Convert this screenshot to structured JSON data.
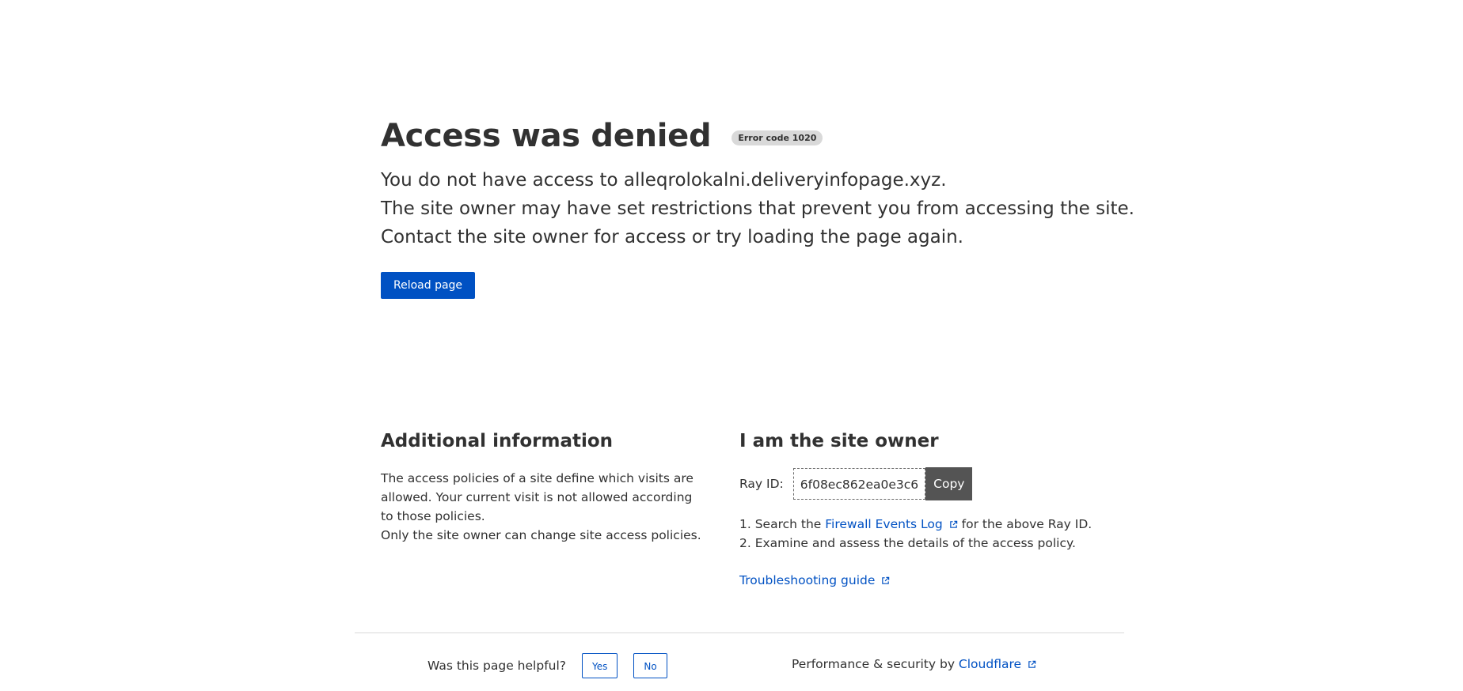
{
  "header": {
    "title": "Access was denied",
    "error_badge": "Error code 1020",
    "desc_line1": "You do not have access to alleqrolokalni.deliveryinfopage.xyz.",
    "desc_line2": "The site owner may have set restrictions that prevent you from accessing the site.",
    "desc_line3": "Contact the site owner for access or try loading the page again.",
    "reload_label": "Reload page"
  },
  "additional_info": {
    "heading": "Additional information",
    "para1": "The access policies of a site define which visits are allowed. Your current visit is not allowed according to those policies.",
    "para2": "Only the site owner can change site access policies."
  },
  "site_owner": {
    "heading": "I am the site owner",
    "ray_label": "Ray ID:",
    "ray_value": "6f08ec862ea0e3c6",
    "copy_label": "Copy",
    "step1_prefix": "1. Search the ",
    "step1_link": "Firewall Events Log",
    "step1_suffix": " for the above Ray ID.",
    "step2": "2. Examine and assess the details of the access policy.",
    "troubleshooting_link": "Troubleshooting guide"
  },
  "footer": {
    "helpful_question": "Was this page helpful?",
    "yes_label": "Yes",
    "no_label": "No",
    "perf_prefix": "Performance & security by ",
    "perf_link": "Cloudflare"
  },
  "colors": {
    "accent": "#0051c3",
    "text": "#313131",
    "badge_bg": "#d9d9d9",
    "copy_bg": "#545454"
  }
}
